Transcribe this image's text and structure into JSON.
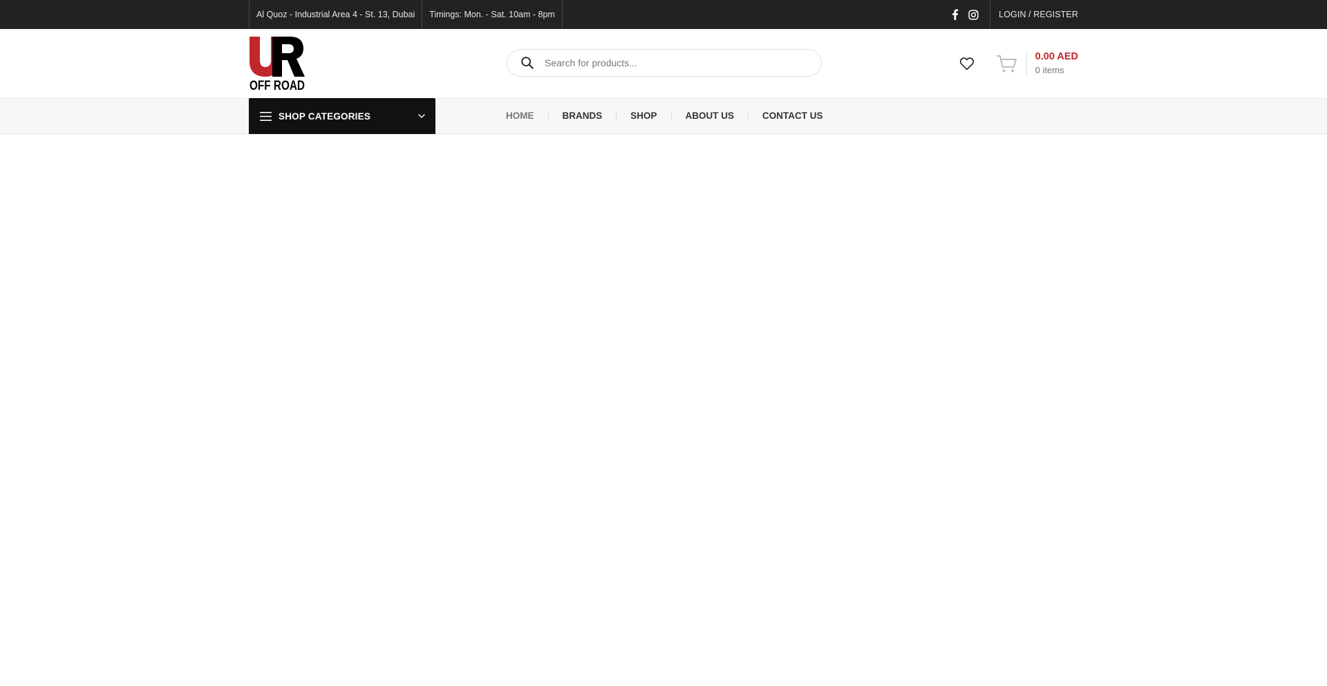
{
  "topbar": {
    "address": "Al Quoz - Industrial Area 4 - St. 13, Dubai",
    "timings": "Timings: Mon. - Sat. 10am - 8pm",
    "social": [
      "facebook-icon",
      "instagram-icon"
    ],
    "login_label": "LOGIN / REGISTER"
  },
  "header": {
    "logo_alt": "UR OFF ROAD",
    "search_placeholder": "Search for products...",
    "cart_total": "0.00 AED",
    "cart_count": "0 items"
  },
  "nav": {
    "categories_label": "SHOP CATEGORIES",
    "items": [
      {
        "label": "HOME"
      },
      {
        "label": "BRANDS"
      },
      {
        "label": "SHOP"
      },
      {
        "label": "ABOUT US"
      },
      {
        "label": "CONTACT US"
      }
    ]
  },
  "colors": {
    "topbar_bg": "#222222",
    "accent_red": "#c1272d",
    "category_button_bg": "#111111"
  }
}
